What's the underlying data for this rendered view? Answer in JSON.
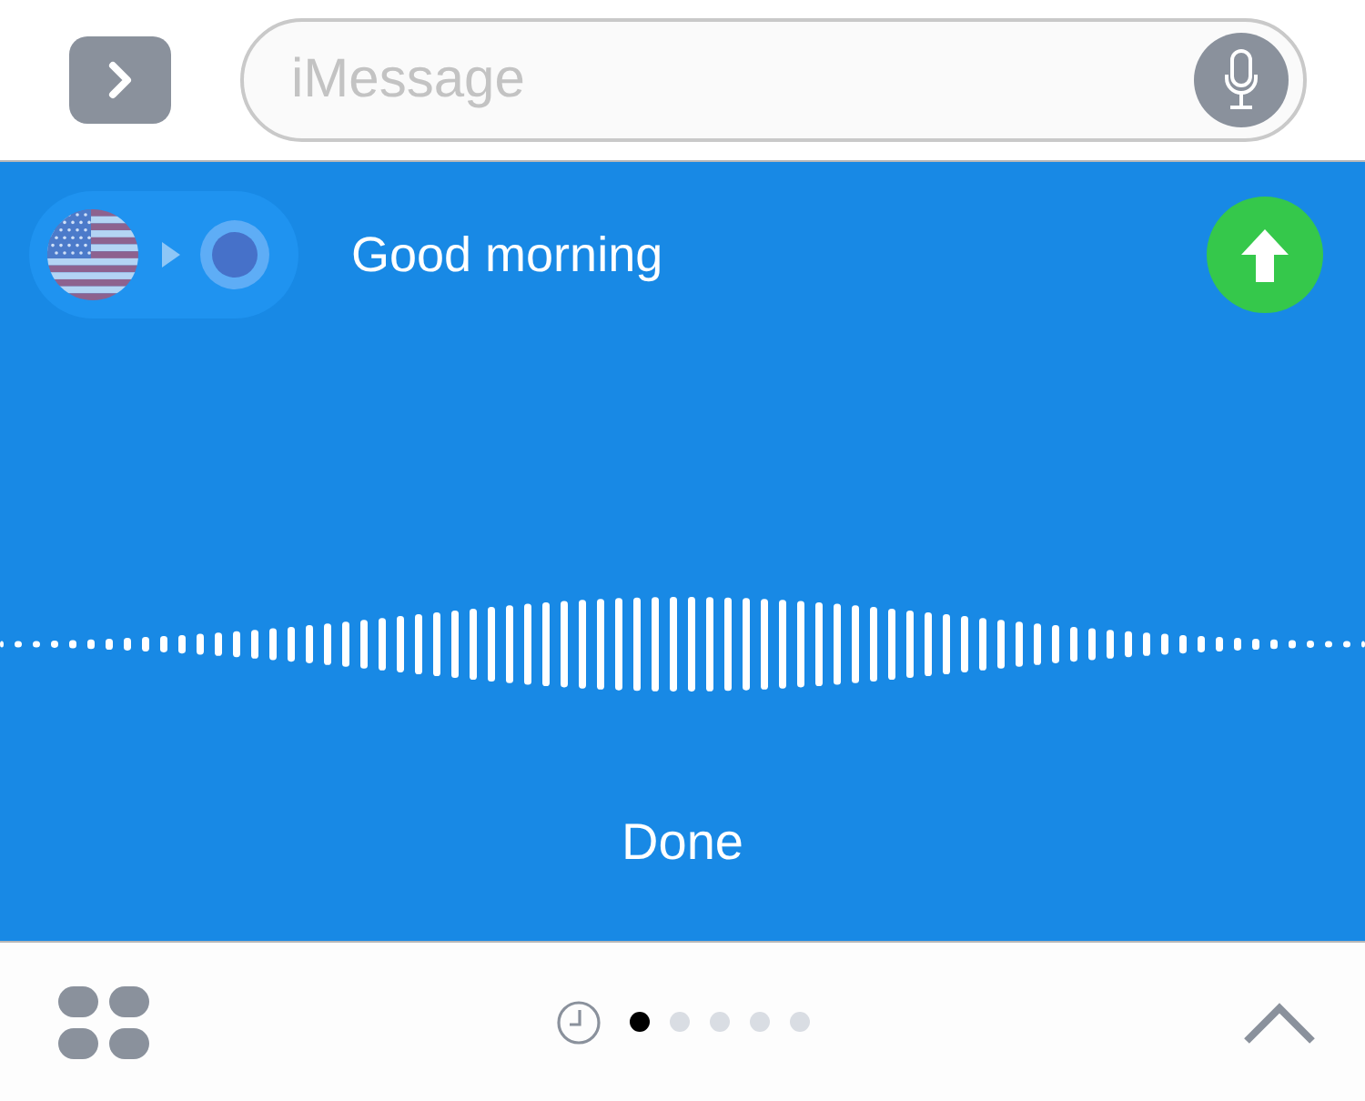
{
  "top_bar": {
    "message_field": {
      "placeholder": "iMessage"
    }
  },
  "translator": {
    "phrase": "Good morning",
    "done_button": "Done"
  },
  "bottom_bar": {
    "pages": [
      {
        "selected": true
      },
      {
        "selected": false
      },
      {
        "selected": false
      },
      {
        "selected": false
      },
      {
        "selected": false
      }
    ]
  }
}
